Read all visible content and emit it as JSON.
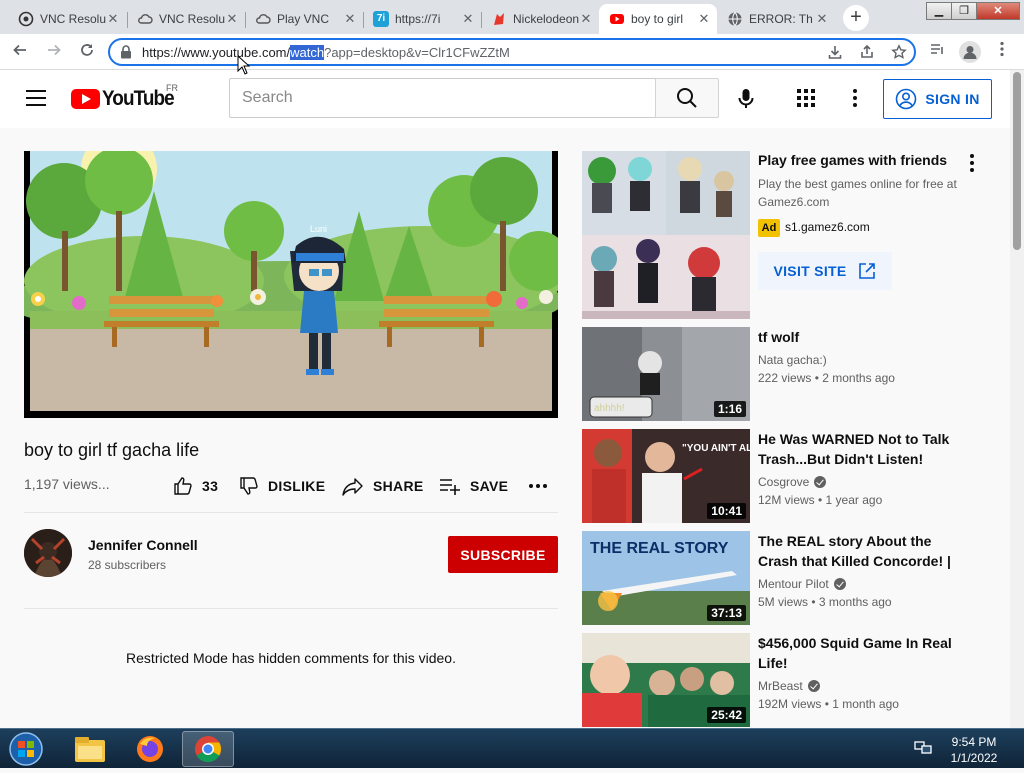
{
  "browser": {
    "tabs": [
      {
        "title": "VNC Resolution",
        "favicon": "vnc-icon",
        "active": false
      },
      {
        "title": "VNC Resolution",
        "favicon": "cloud-icon",
        "active": false
      },
      {
        "title": "Play VNC",
        "favicon": "cloud-icon",
        "active": false
      },
      {
        "title": "https://7i",
        "favicon": "7i-icon",
        "active": false
      },
      {
        "title": "Nickelodeon",
        "favicon": "nick-icon",
        "active": false
      },
      {
        "title": "boy to girl",
        "favicon": "youtube-icon",
        "active": true
      },
      {
        "title": "ERROR: Th",
        "favicon": "globe-icon",
        "active": false
      }
    ],
    "new_tab": "+",
    "url": {
      "prefix": "https://www.youtube.com/",
      "selected": "watch",
      "suffix": "?app=desktop&v=Clr1CFwZZtM"
    }
  },
  "youtube": {
    "logo_text": "YouTube",
    "region": "FR",
    "search_placeholder": "Search",
    "sign_in": "SIGN IN",
    "video": {
      "title": "boy to girl tf gacha life",
      "views": "1,197 views...",
      "like_count": "33",
      "dislike": "DISLIKE",
      "share": "SHARE",
      "save": "SAVE",
      "overlay_name": "Luni"
    },
    "channel": {
      "name": "Jennifer Connell",
      "subscribers": "28 subscribers",
      "subscribe": "SUBSCRIBE"
    },
    "comments_notice": "Restricted Mode has hidden comments for this video.",
    "ad": {
      "title": "Play free games with friends",
      "description": "Play the best games online for free at Gamez6.com",
      "badge": "Ad",
      "domain": "s1.gamez6.com",
      "cta": "VISIT SITE"
    },
    "related": [
      {
        "title": "tf wolf",
        "channel": "Nata gacha:)",
        "verified": false,
        "meta": "222 views • 2 months ago",
        "duration": "1:16",
        "thumb_text": "ahhhh!"
      },
      {
        "title": "He Was WARNED Not to Talk Trash...But Didn't Listen!",
        "channel": "Cosgrove",
        "verified": true,
        "meta": "12M views • 1 year ago",
        "duration": "10:41",
        "thumb_text": "\"YOU AIN'T ALL THAT\""
      },
      {
        "title": "The REAL story About the Crash that Killed Concorde! | Air...",
        "channel": "Mentour Pilot",
        "verified": true,
        "meta": "5M views • 3 months ago",
        "duration": "37:13",
        "thumb_text": "THE REAL STORY"
      },
      {
        "title": "$456,000 Squid Game In Real Life!",
        "channel": "MrBeast",
        "verified": true,
        "meta": "192M views • 1 month ago",
        "duration": "25:42",
        "thumb_text": ""
      }
    ]
  },
  "taskbar": {
    "time": "9:54 PM",
    "date": "1/1/2022"
  },
  "colors": {
    "youtube_red": "#ff0000",
    "subscribe_red": "#cc0000",
    "link_blue": "#065fd4",
    "focus_blue": "#1a73e8",
    "ad_badge": "#f2c200"
  }
}
